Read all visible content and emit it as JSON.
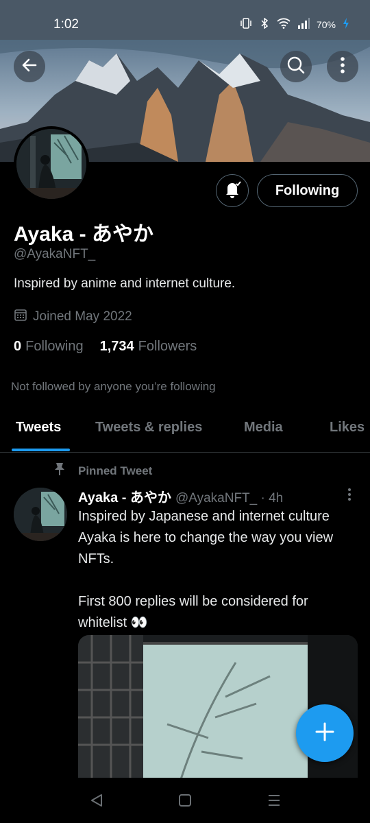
{
  "status_bar": {
    "time": "1:02",
    "battery": "70%"
  },
  "profile": {
    "name": "Ayaka - あやか",
    "handle": "@AyakaNFT_",
    "bio": "Inspired by anime and internet culture.",
    "joined": "Joined May 2022",
    "following_count": "0",
    "following_label": "Following",
    "followers_count": "1,734",
    "followers_label": "Followers",
    "follow_button": "Following",
    "not_followed_note": "Not followed by anyone you’re following"
  },
  "tabs": [
    {
      "label": "Tweets",
      "active": true
    },
    {
      "label": "Tweets & replies",
      "active": false
    },
    {
      "label": "Media",
      "active": false
    },
    {
      "label": "Likes",
      "active": false
    }
  ],
  "pinned_tweet": {
    "pinned_label": "Pinned Tweet",
    "author_name": "Ayaka - あやか",
    "author_handle": "@AyakaNFT_ · 4h",
    "text": "Inspired by Japanese and internet culture Ayaka is here to change the way you view NFTs.\n\nFirst 800 replies will be considered for whitelist 👀"
  },
  "colors": {
    "accent": "#1d9bf0",
    "background": "#000000",
    "muted": "#71767b"
  },
  "icons": [
    "back-arrow-icon",
    "search-icon",
    "more-vertical-icon",
    "bell-check-icon",
    "calendar-icon",
    "pin-icon",
    "plus-icon",
    "nav-back-icon",
    "nav-home-icon",
    "nav-recents-icon"
  ]
}
